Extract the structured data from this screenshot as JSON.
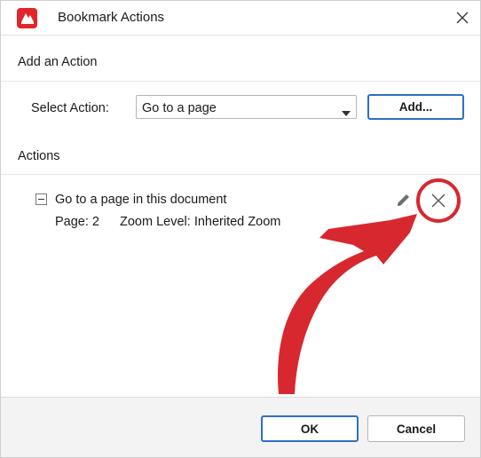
{
  "window": {
    "title": "Bookmark Actions",
    "close_icon": "close-icon",
    "logo_icon": "app-logo-icon",
    "brand_color": "#e0262b"
  },
  "add_section": {
    "heading": "Add an Action",
    "select_label": "Select Action:",
    "select_value": "Go to a page",
    "add_button": "Add..."
  },
  "actions_section": {
    "heading": "Actions",
    "items": [
      {
        "title": "Go to a page in this document",
        "page": "Page: 2",
        "zoom": "Zoom Level: Inherited Zoom",
        "edit_icon": "pencil-icon",
        "delete_icon": "close-icon"
      }
    ]
  },
  "footer": {
    "ok_button": "OK",
    "cancel_button": "Cancel"
  },
  "annotation": {
    "color": "#d7282f",
    "shape": "circle-and-arrow"
  }
}
